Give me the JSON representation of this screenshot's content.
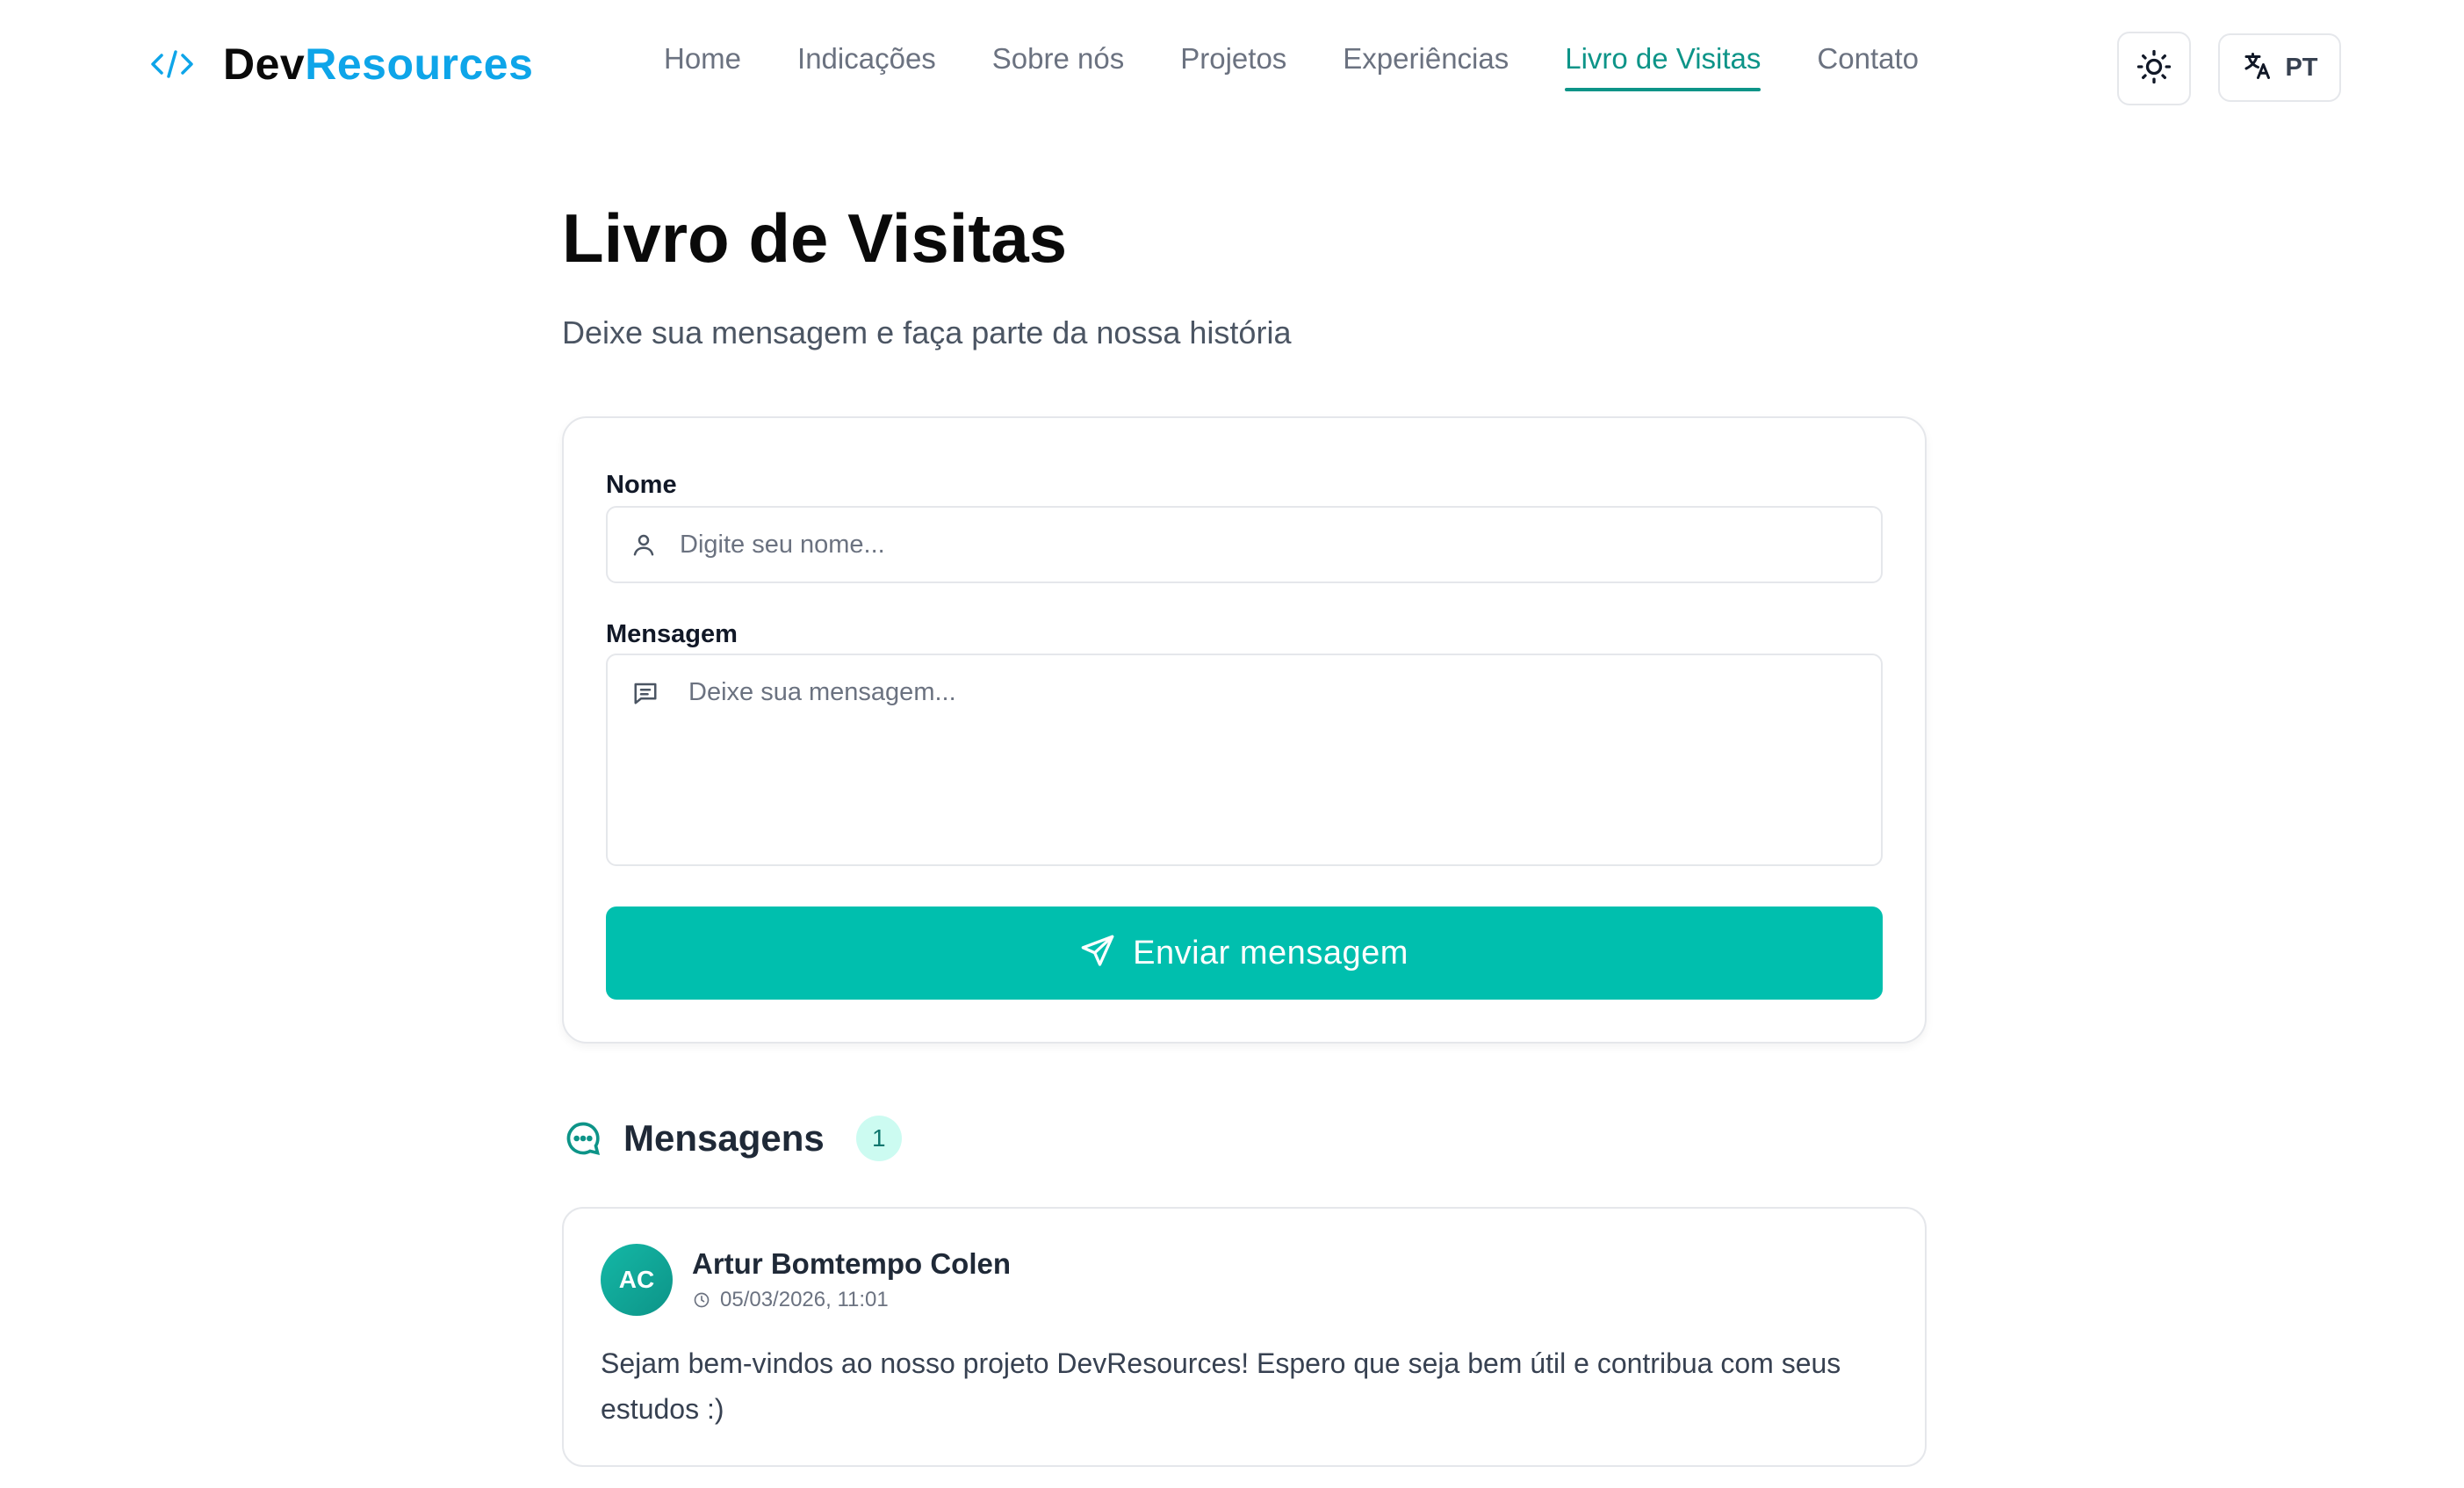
{
  "brand": {
    "prefix": "Dev",
    "suffix": "Resources"
  },
  "nav": {
    "items": [
      {
        "label": "Home"
      },
      {
        "label": "Indicações"
      },
      {
        "label": "Sobre nós"
      },
      {
        "label": "Projetos"
      },
      {
        "label": "Experiências"
      },
      {
        "label": "Livro de Visitas",
        "active": true
      },
      {
        "label": "Contato"
      }
    ]
  },
  "controls": {
    "theme_icon": "sun-icon",
    "lang_icon": "translate-icon",
    "lang_label": "PT"
  },
  "page": {
    "title": "Livro de Visitas",
    "subtitle": "Deixe sua mensagem e faça parte da nossa história"
  },
  "form": {
    "name_label": "Nome",
    "name_placeholder": "Digite seu nome...",
    "message_label": "Mensagem",
    "message_placeholder": "Deixe sua mensagem...",
    "submit_label": "Enviar mensagem"
  },
  "messages": {
    "title": "Mensagens",
    "count": "1",
    "items": [
      {
        "initials": "AC",
        "author": "Artur Bomtempo Colen",
        "timestamp": "05/03/2026, 11:01",
        "text": "Sejam bem-vindos ao nosso projeto DevResources! Espero que seja bem útil e contribua com seus estudos :)"
      }
    ]
  },
  "colors": {
    "accent": "#00bfae",
    "brand_blue": "#0ea5e9",
    "active_nav": "#0d9488"
  }
}
